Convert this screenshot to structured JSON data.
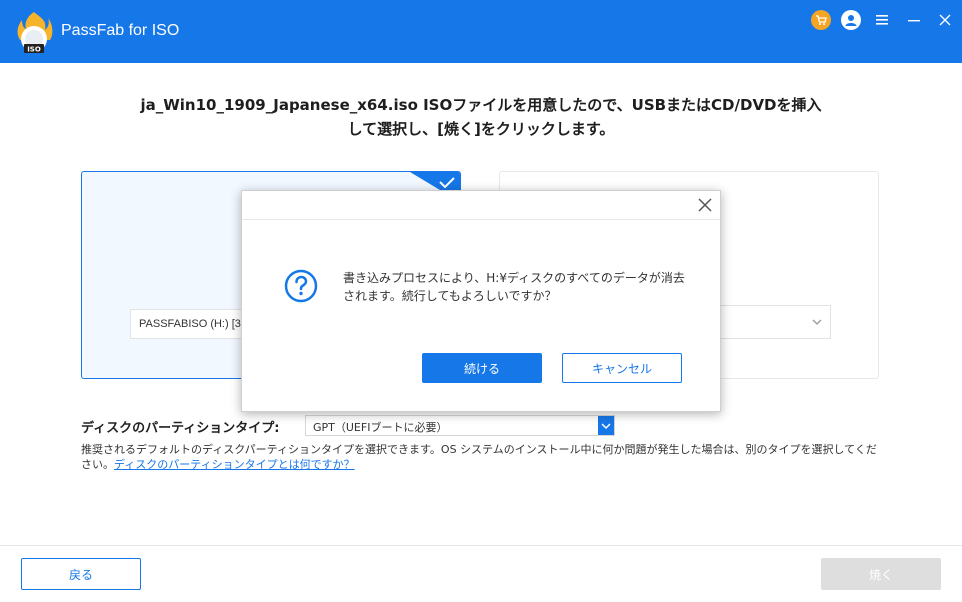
{
  "app": {
    "title": "PassFab for ISO",
    "logo_text": "ISO",
    "accent_color": "#1677e8"
  },
  "titlebar": {
    "icons": [
      "cart-icon",
      "user-icon",
      "menu-icon",
      "minimize-icon",
      "close-icon"
    ]
  },
  "main": {
    "headline_line1": "ja_Win10_1909_Japanese_x64.iso ISOファイルを用意したので、USBまたはCD/DVDを挿入",
    "headline_line2": "して選択し、[焼く]をクリックします。",
    "usb_card": {
      "selected": true,
      "drive_value": "PASSFABISO (H:) [3"
    },
    "cd_card": {
      "selected": false
    },
    "partition": {
      "label": "ディスクのパーティションタイプ:",
      "value": "GPT（UEFIブートに必要）"
    },
    "help_text": "推奨されるデフォルトのディスクパーティションタイプを選択できます。OS システムのインストール中に何か問題が発生した場合は、別のタイプを選択してください。",
    "help_link": "ディスクのパーティションタイプとは何ですか？"
  },
  "footer": {
    "back_label": "戻る",
    "burn_label": "焼く",
    "burn_enabled": false
  },
  "dialog": {
    "message": "書き込みプロセスにより、H:¥ディスクのすべてのデータが消去されます。続行してもよろしいですか？",
    "continue_label": "続ける",
    "cancel_label": "キャンセル"
  }
}
